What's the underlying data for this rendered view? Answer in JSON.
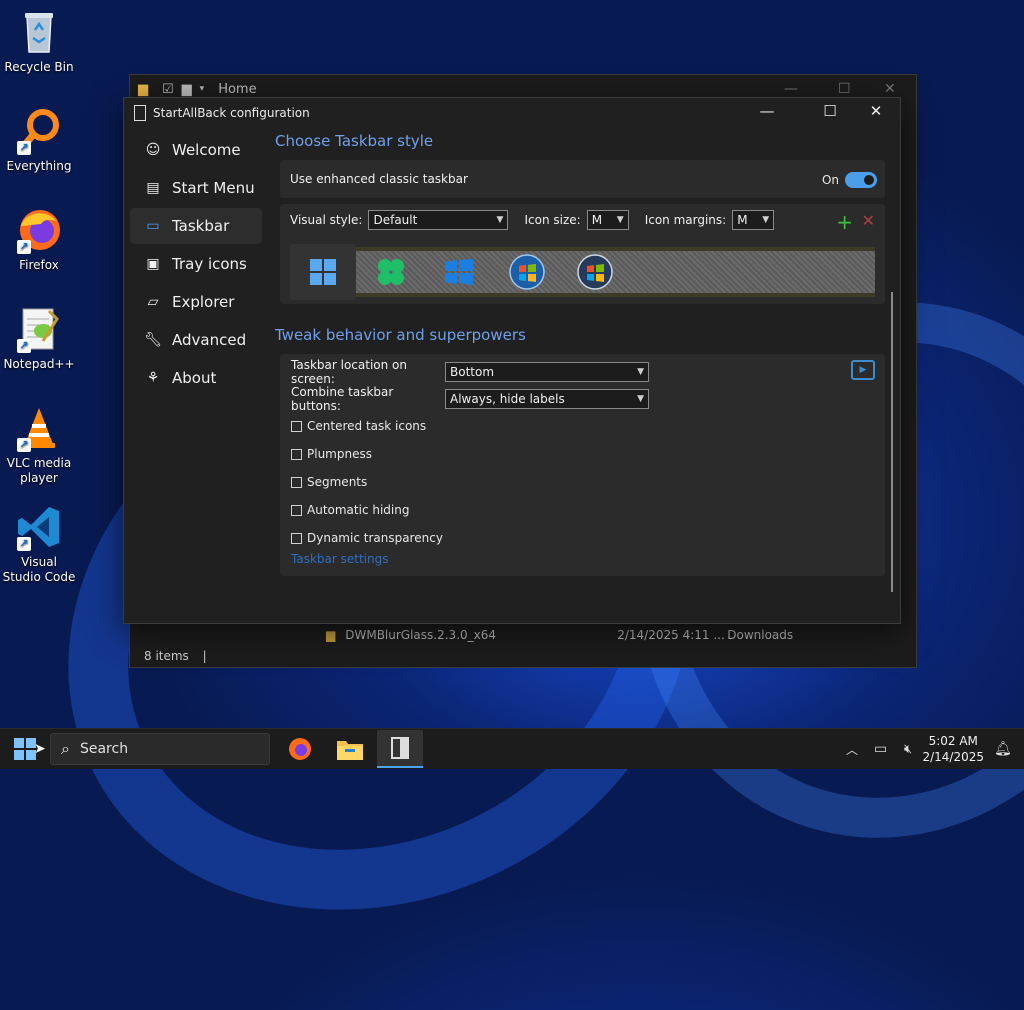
{
  "desktop": {
    "icons": [
      {
        "label": "Recycle Bin"
      },
      {
        "label": "Everything"
      },
      {
        "label": "Firefox"
      },
      {
        "label": "Notepad++"
      },
      {
        "label": "VLC media player"
      },
      {
        "label": "Visual Studio Code"
      }
    ]
  },
  "explorer": {
    "location": "Home",
    "file_row": {
      "name": "DWMBlurGlass.2.3.0_x64",
      "date": "2/14/2025 4:11 ...",
      "location": "Downloads"
    },
    "status": "8 items"
  },
  "config": {
    "title": "StartAllBack configuration",
    "nav": [
      {
        "label": "Welcome",
        "icon": "smile-icon"
      },
      {
        "label": "Start Menu",
        "icon": "start-menu-icon"
      },
      {
        "label": "Taskbar",
        "icon": "taskbar-icon",
        "active": true
      },
      {
        "label": "Tray icons",
        "icon": "tray-icon"
      },
      {
        "label": "Explorer",
        "icon": "folder-icon"
      },
      {
        "label": "Advanced",
        "icon": "wrench-icon"
      },
      {
        "label": "About",
        "icon": "about-icon"
      }
    ],
    "taskbar_style": {
      "heading": "Choose Taskbar style",
      "enhanced_label": "Use enhanced classic taskbar",
      "enhanced_state": "On",
      "visual_style_label": "Visual style:",
      "visual_style_value": "Default",
      "icon_size_label": "Icon size:",
      "icon_size_value": "M",
      "icon_margins_label": "Icon margins:",
      "icon_margins_value": "M"
    },
    "behavior": {
      "heading": "Tweak behavior and superpowers",
      "location_label": "Taskbar location on screen:",
      "location_value": "Bottom",
      "combine_label": "Combine taskbar buttons:",
      "combine_value": "Always, hide labels",
      "checkboxes": [
        {
          "label": "Centered task icons",
          "checked": false
        },
        {
          "label": "Plumpness",
          "checked": false
        },
        {
          "label": "Segments",
          "checked": false
        },
        {
          "label": "Automatic hiding",
          "checked": false
        },
        {
          "label": "Dynamic transparency",
          "checked": false
        }
      ],
      "settings_link": "Taskbar settings"
    }
  },
  "taskbar": {
    "search_placeholder": "Search",
    "time": "5:02 AM",
    "date": "2/14/2025"
  },
  "colors": {
    "accent": "#4c9ee8",
    "heading": "#6fa0e8",
    "window_bg": "#202020",
    "panel_bg": "#2b2b2b"
  }
}
